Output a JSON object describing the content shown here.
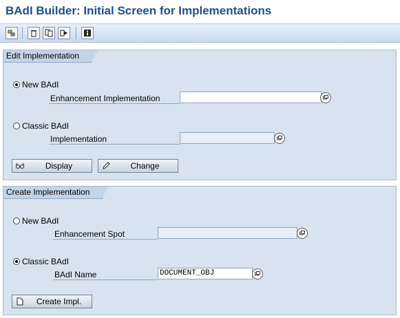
{
  "window": {
    "title": "BAdI Builder: Initial Screen for Implementations"
  },
  "toolbar": {
    "icons": [
      "object-list-icon",
      "delete-icon",
      "copy-icon",
      "rename-icon",
      "info-icon"
    ]
  },
  "edit": {
    "section_title": "Edit Implementation",
    "radio_new": "New BAdI",
    "enh_impl_label": "Enhancement Implementation",
    "enh_impl_value": "",
    "radio_classic": "Classic BAdI",
    "impl_label": "Implementation",
    "impl_value": "",
    "display_btn": "Display",
    "change_btn": "Change"
  },
  "create": {
    "section_title": "Create Implementation",
    "radio_new": "New BAdI",
    "spot_label": "Enhancement Spot",
    "spot_value": "",
    "radio_classic": "Classic BAdI",
    "badi_label": "BAdI Name",
    "badi_value": "DOCUMENT_OBJ",
    "create_btn": "Create Impl."
  }
}
